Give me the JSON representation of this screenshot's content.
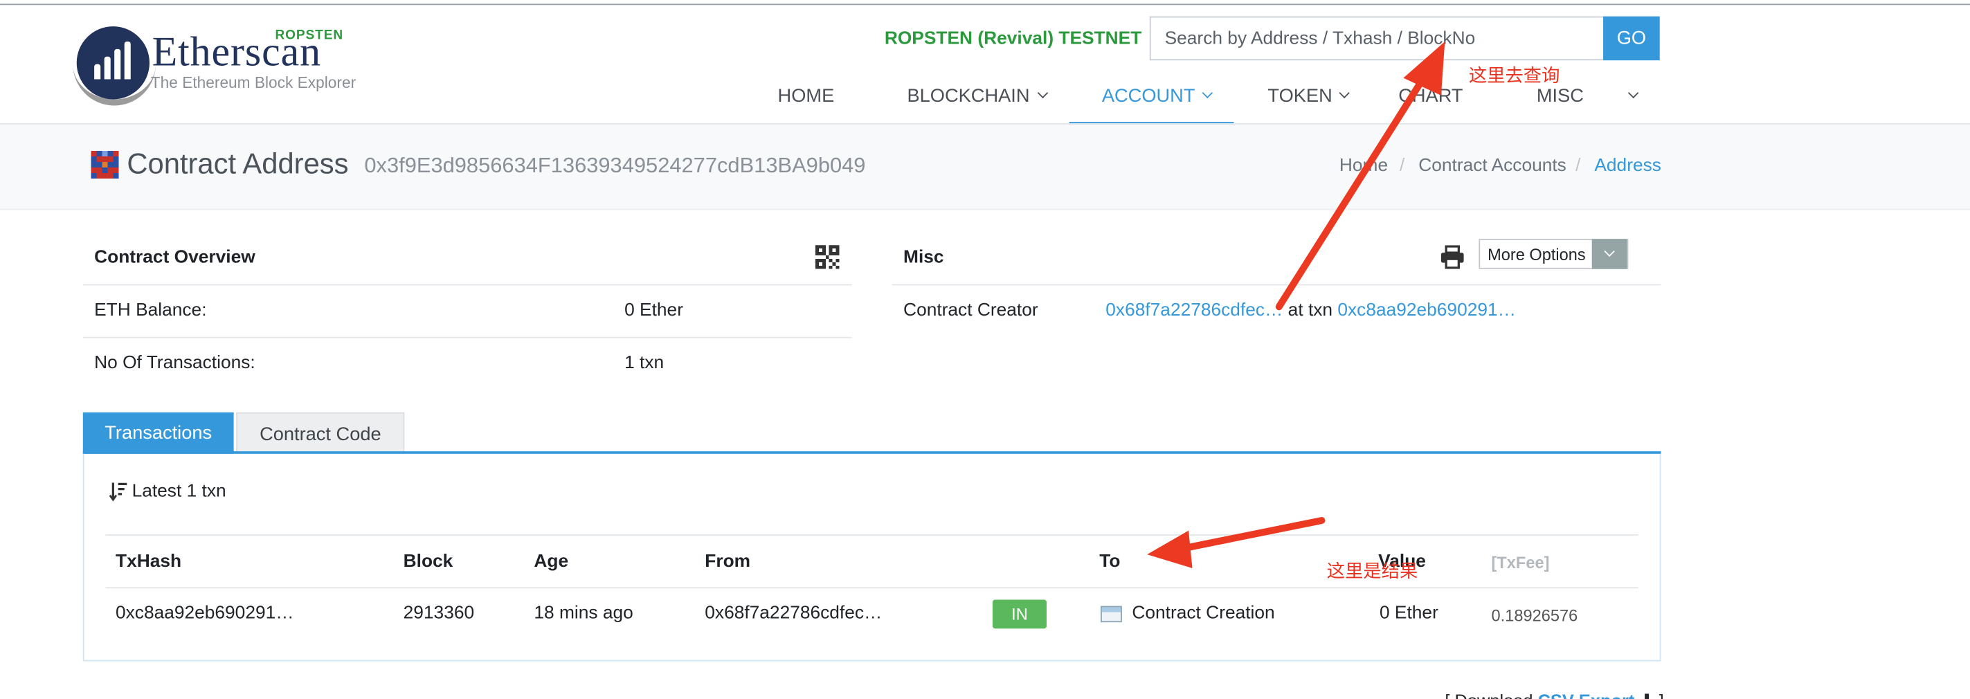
{
  "header": {
    "logo": {
      "name": "Etherscan",
      "tagline": "The Ethereum Block Explorer",
      "network_badge": "ROPSTEN"
    },
    "network_label": "ROPSTEN (Revival) TESTNET",
    "search": {
      "placeholder": "Search by Address / Txhash / BlockNo",
      "button_label": "GO"
    },
    "nav": [
      {
        "label": "HOME",
        "dropdown": false,
        "active": false
      },
      {
        "label": "BLOCKCHAIN",
        "dropdown": true,
        "active": false
      },
      {
        "label": "ACCOUNT",
        "dropdown": true,
        "active": true
      },
      {
        "label": "TOKEN",
        "dropdown": true,
        "active": false
      },
      {
        "label": "CHART",
        "dropdown": false,
        "active": false
      },
      {
        "label": "MISC",
        "dropdown": true,
        "active": false
      }
    ]
  },
  "title_bar": {
    "title": "Contract Address",
    "address": "0x3f9E3d9856634F13639349524277cdB13BA9b049",
    "breadcrumb": [
      "Home",
      "Contract Accounts",
      "Address"
    ]
  },
  "overview": {
    "heading": "Contract Overview",
    "rows": [
      {
        "label": "ETH Balance:",
        "value": "0 Ether"
      },
      {
        "label": "No Of Transactions:",
        "value": "1 txn"
      }
    ]
  },
  "misc": {
    "heading": "Misc",
    "more_options_label": "More Options",
    "creator_label": "Contract Creator",
    "creator_address": "0x68f7a22786cdfec…",
    "at_txn_label": "at txn",
    "creator_txn": "0xc8aa92eb690291…"
  },
  "tabs": [
    {
      "label": "Transactions",
      "active": true
    },
    {
      "label": "Contract Code",
      "active": false
    }
  ],
  "transactions": {
    "summary": "Latest 1 txn",
    "columns": [
      "TxHash",
      "Block",
      "Age",
      "From",
      "To",
      "Value",
      "[TxFee]"
    ],
    "rows": [
      {
        "txhash": "0xc8aa92eb690291…",
        "block": "2913360",
        "age": "18 mins ago",
        "from": "0x68f7a22786cdfec…",
        "direction": "IN",
        "to": "Contract Creation",
        "value": "0 Ether",
        "fee": "0.18926576"
      }
    ]
  },
  "footer": {
    "download_label": "[ Download",
    "csv_label": "CSV Export",
    "close_bracket": "]"
  },
  "annotations": {
    "search_note": "这里去查询",
    "result_note": "这里是结果"
  },
  "colors": {
    "accent": "#3498db",
    "network_green": "#2b9a3d",
    "badge_in": "#5cb85c",
    "annotation_red": "#e8321f",
    "logo_navy": "#21325b"
  }
}
